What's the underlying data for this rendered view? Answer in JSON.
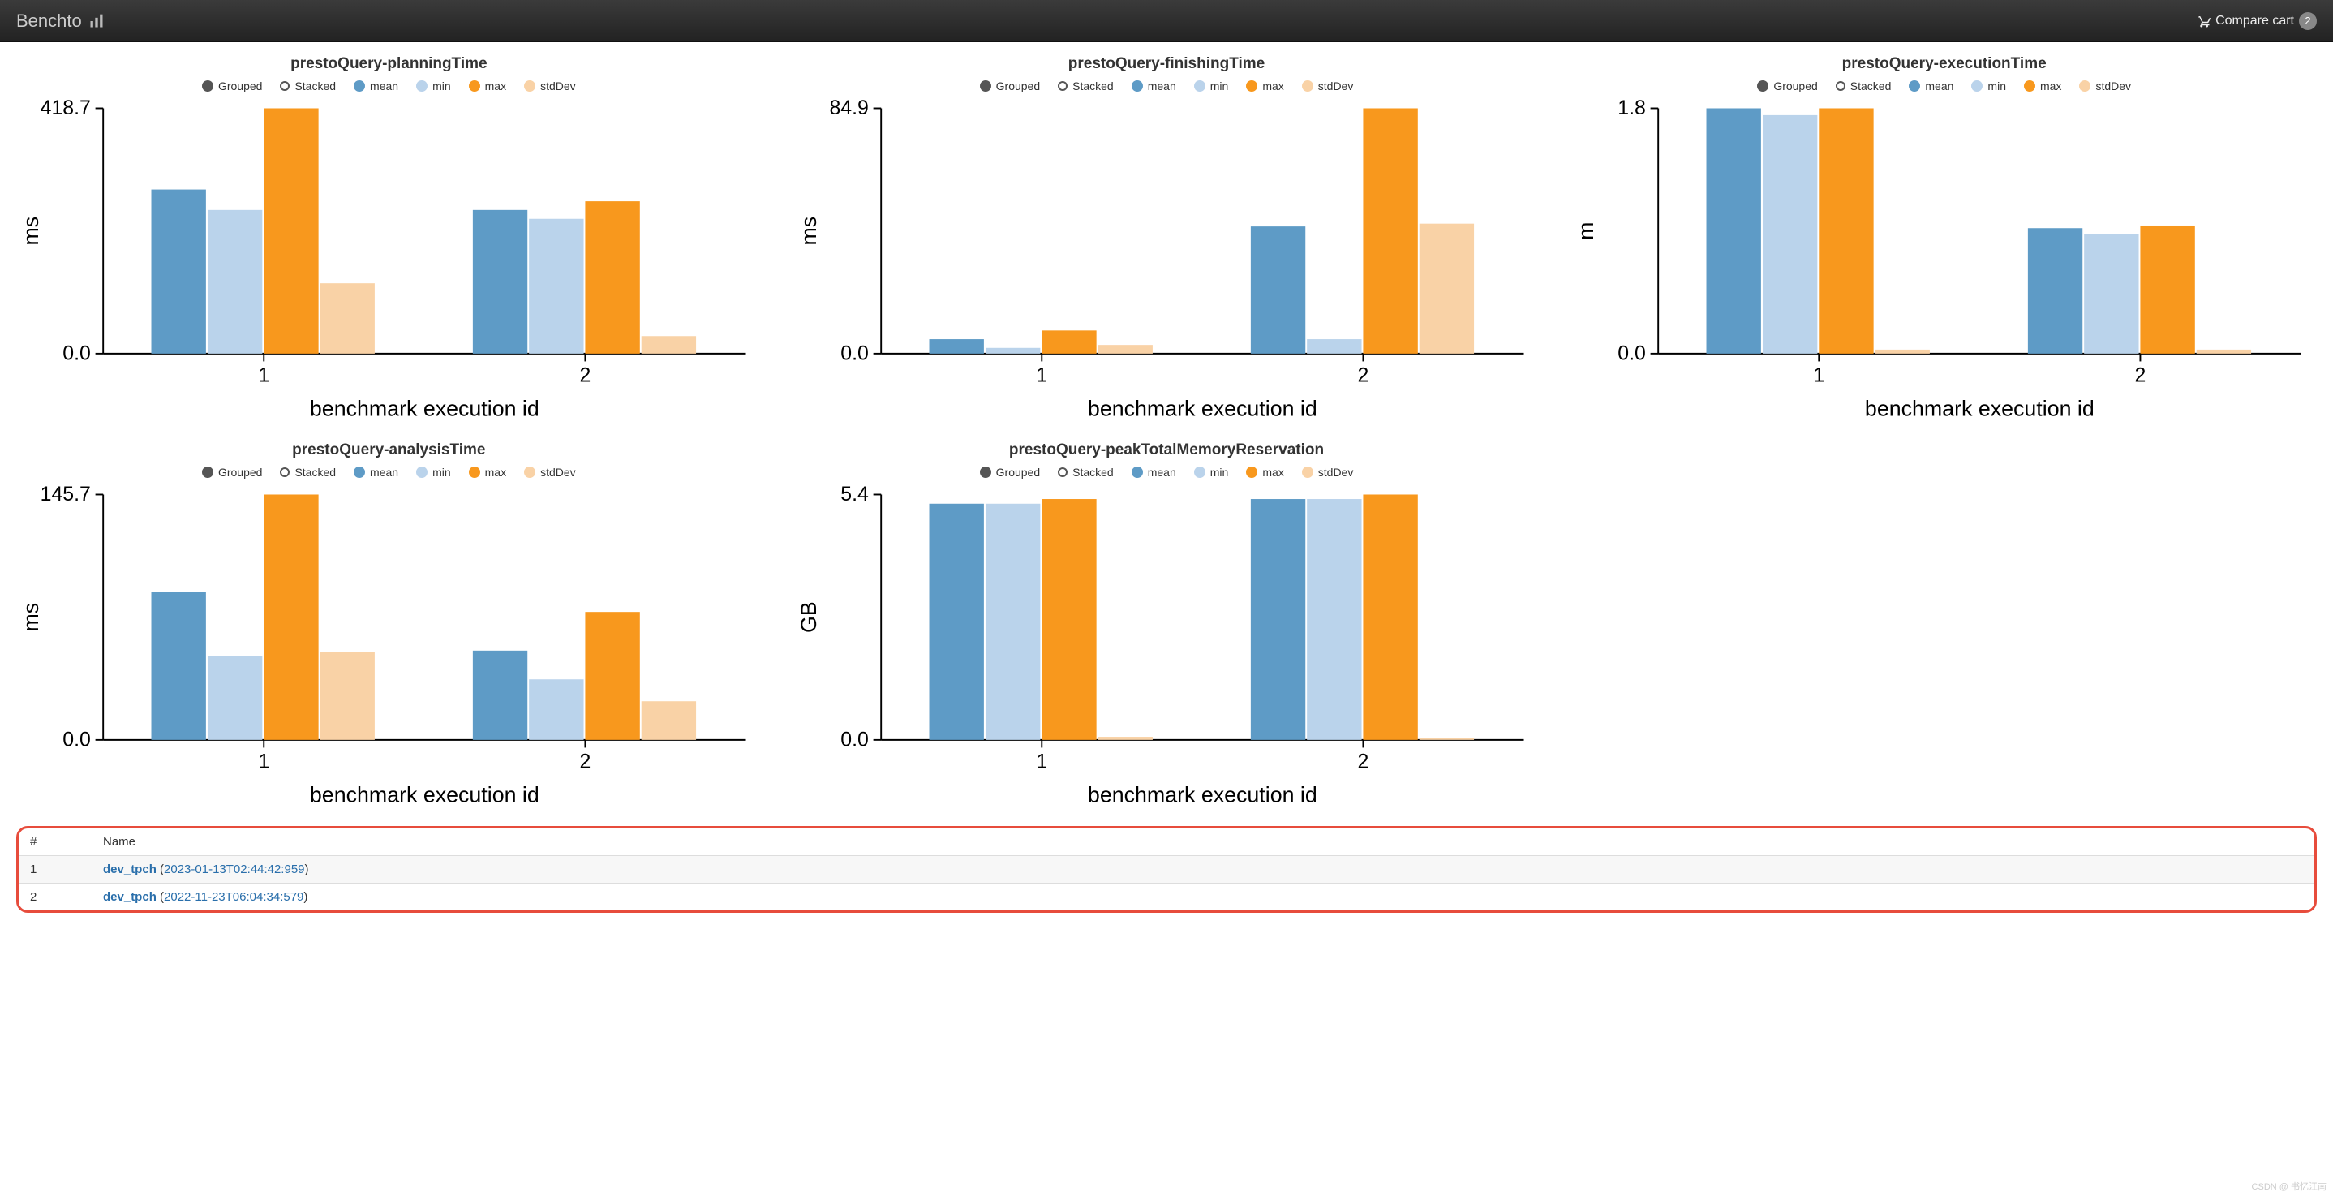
{
  "header": {
    "brand": "Benchto",
    "cart_label": "Compare cart",
    "cart_count": "2"
  },
  "colors": {
    "mean": "#5E9BC6",
    "min": "#BAD3EB",
    "max": "#F8981D",
    "stdDev": "#F9D2A6"
  },
  "legend": {
    "grouped": "Grouped",
    "stacked": "Stacked",
    "mean": "mean",
    "min": "min",
    "max": "max",
    "stdDev": "stdDev"
  },
  "chart_data": [
    {
      "id": "planningTime",
      "title": "prestoQuery-planningTime",
      "type": "bar",
      "ylabel": "ms",
      "xlabel": "benchmark execution id",
      "ymax_label": "418.7",
      "ylim": [
        0,
        418.7
      ],
      "categories": [
        "1",
        "2"
      ],
      "series": [
        {
          "name": "mean",
          "values": [
            280,
            245
          ]
        },
        {
          "name": "min",
          "values": [
            245,
            230
          ]
        },
        {
          "name": "max",
          "values": [
            418.7,
            260
          ]
        },
        {
          "name": "stdDev",
          "values": [
            120,
            30
          ]
        }
      ]
    },
    {
      "id": "finishingTime",
      "title": "prestoQuery-finishingTime",
      "type": "bar",
      "ylabel": "ms",
      "xlabel": "benchmark execution id",
      "ymax_label": "84.9",
      "ylim": [
        0,
        84.9
      ],
      "categories": [
        "1",
        "2"
      ],
      "series": [
        {
          "name": "mean",
          "values": [
            5,
            44
          ]
        },
        {
          "name": "min",
          "values": [
            2,
            5
          ]
        },
        {
          "name": "max",
          "values": [
            8,
            84.9
          ]
        },
        {
          "name": "stdDev",
          "values": [
            3,
            45
          ]
        }
      ]
    },
    {
      "id": "executionTime",
      "title": "prestoQuery-executionTime",
      "type": "bar",
      "ylabel": "m",
      "xlabel": "benchmark execution id",
      "ymax_label": "1.8",
      "ylim": [
        0,
        1.8
      ],
      "categories": [
        "1",
        "2"
      ],
      "series": [
        {
          "name": "mean",
          "values": [
            1.8,
            0.92
          ]
        },
        {
          "name": "min",
          "values": [
            1.75,
            0.88
          ]
        },
        {
          "name": "max",
          "values": [
            1.8,
            0.94
          ]
        },
        {
          "name": "stdDev",
          "values": [
            0.03,
            0.03
          ]
        }
      ]
    },
    {
      "id": "analysisTime",
      "title": "prestoQuery-analysisTime",
      "type": "bar",
      "ylabel": "ms",
      "xlabel": "benchmark execution id",
      "ymax_label": "145.7",
      "ylim": [
        0,
        145.7
      ],
      "categories": [
        "1",
        "2"
      ],
      "series": [
        {
          "name": "mean",
          "values": [
            88,
            53
          ]
        },
        {
          "name": "min",
          "values": [
            50,
            36
          ]
        },
        {
          "name": "max",
          "values": [
            145.7,
            76
          ]
        },
        {
          "name": "stdDev",
          "values": [
            52,
            23
          ]
        }
      ]
    },
    {
      "id": "peakTotalMemoryReservation",
      "title": "prestoQuery-peakTotalMemoryReservation",
      "type": "bar",
      "ylabel": "GB",
      "xlabel": "benchmark execution id",
      "ymax_label": "5.4",
      "ylim": [
        0,
        5.4
      ],
      "categories": [
        "1",
        "2"
      ],
      "series": [
        {
          "name": "mean",
          "values": [
            5.2,
            5.3
          ]
        },
        {
          "name": "min",
          "values": [
            5.2,
            5.3
          ]
        },
        {
          "name": "max",
          "values": [
            5.3,
            5.4
          ]
        },
        {
          "name": "stdDev",
          "values": [
            0.07,
            0.05
          ]
        }
      ]
    }
  ],
  "table": {
    "headers": {
      "index": "#",
      "name": "Name"
    },
    "rows": [
      {
        "index": "1",
        "name": "dev_tpch",
        "date": "2023-01-13T02:44:42:959"
      },
      {
        "index": "2",
        "name": "dev_tpch",
        "date": "2022-11-23T06:04:34:579"
      }
    ]
  },
  "watermark": "CSDN @ 书忆江南"
}
